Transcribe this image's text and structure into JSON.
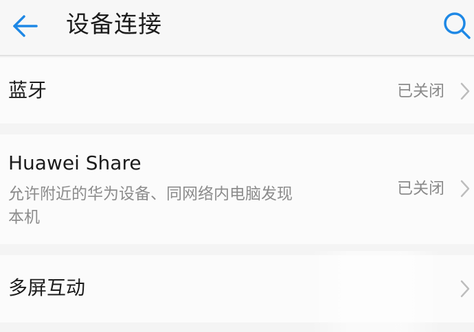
{
  "header": {
    "title": "设备连接",
    "back_icon": "back-arrow-icon",
    "search_icon": "search-icon",
    "accent_color": "#1e88e5"
  },
  "settings": {
    "bluetooth": {
      "label": "蓝牙",
      "status": "已关闭",
      "chevron_icon": "chevron-right-icon"
    },
    "huawei_share": {
      "label": "Huawei Share",
      "description": "允许附近的华为设备、同网络内电脑发现本机",
      "status": "已关闭",
      "chevron_icon": "chevron-right-icon"
    },
    "multi_screen": {
      "label": "多屏互动",
      "chevron_icon": "chevron-right-icon"
    }
  }
}
